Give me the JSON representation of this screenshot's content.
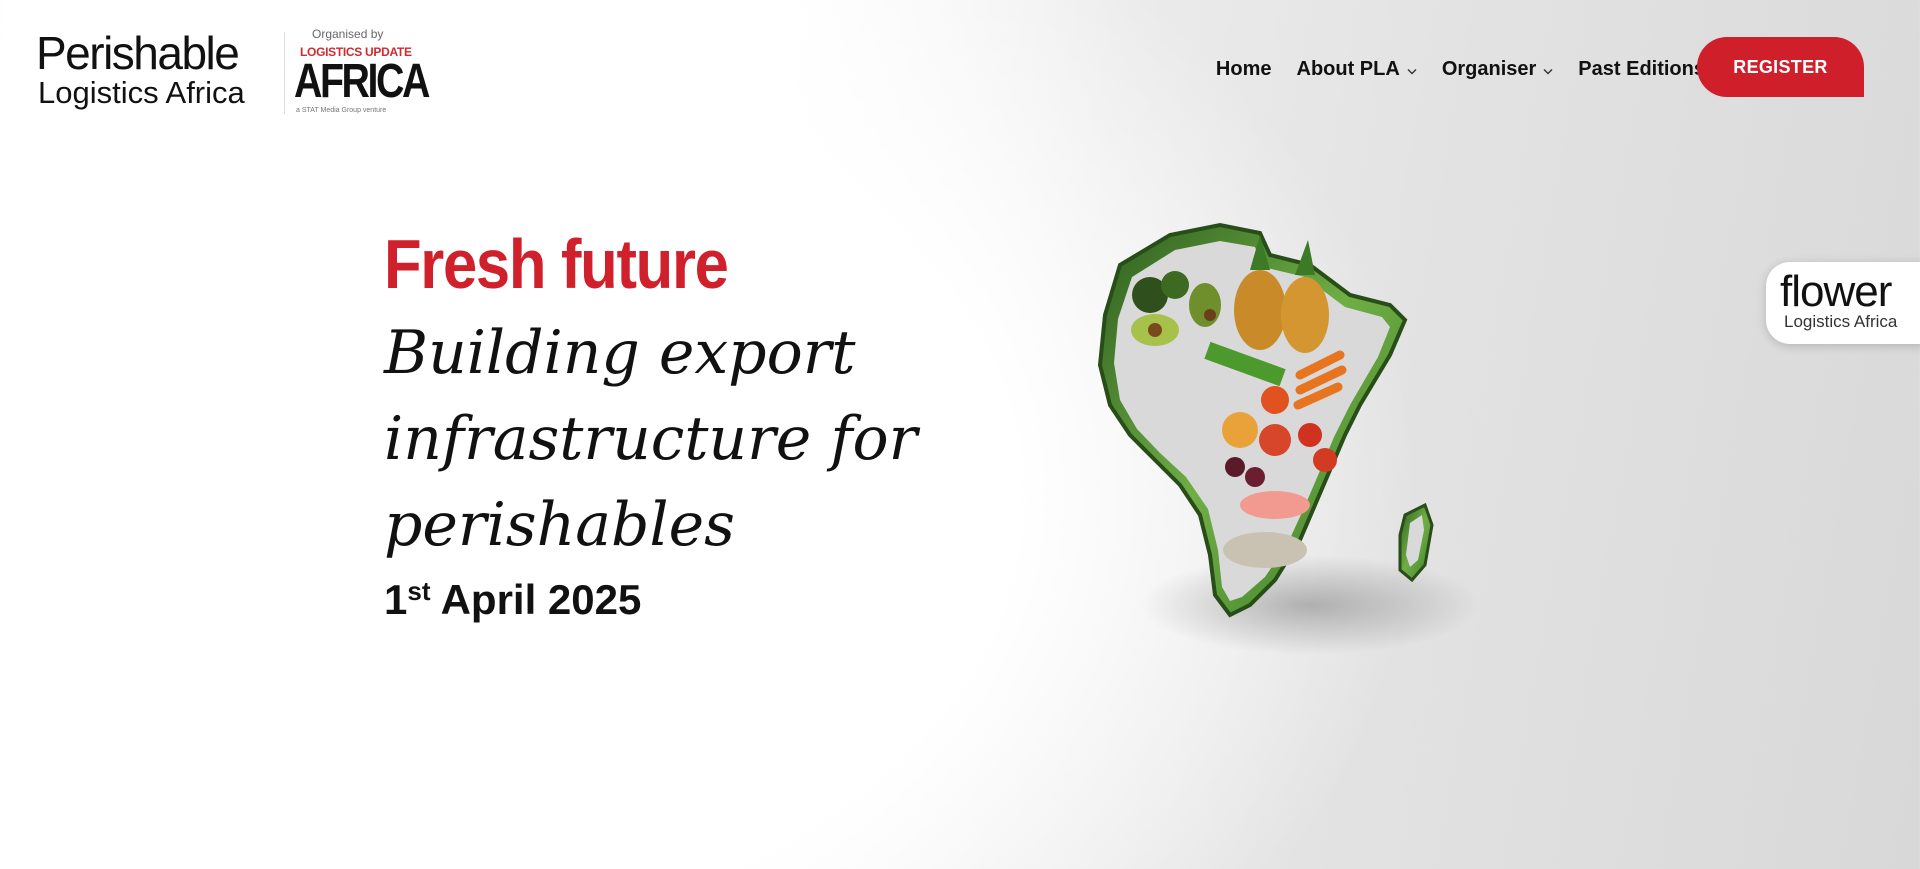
{
  "header": {
    "logo": {
      "line1": "Perishable",
      "line2": "Logistics Africa",
      "organised_by": "Organised by",
      "logistics_update": "LOGISTICS UPDATE",
      "africa": "AFRICA",
      "stat": "a STAT Media Group venture"
    },
    "nav": [
      {
        "label": "Home",
        "icon": null
      },
      {
        "label": "About PLA",
        "icon": "chevron-down-icon"
      },
      {
        "label": "Organiser",
        "icon": "chevron-down-icon"
      },
      {
        "label": "Past Editions",
        "icon": "chevron-down-icon"
      }
    ],
    "register_label": "REGISTER"
  },
  "hero": {
    "highlight": "Fresh future",
    "subtitle": "Building export infrastructure for perishables",
    "date_day": "1",
    "date_suffix": "st",
    "date_rest": " April 2025"
  },
  "flower_badge": {
    "word": "flower",
    "sub": "Logistics Africa"
  },
  "colors": {
    "brand_red": "#cf1f2b",
    "text": "#111111",
    "leaf_green": "#3e8b2a"
  },
  "icons": {
    "apple": "apple-icon",
    "chevron": "chevron-down-icon",
    "africa": "africa-produce-illustration"
  }
}
